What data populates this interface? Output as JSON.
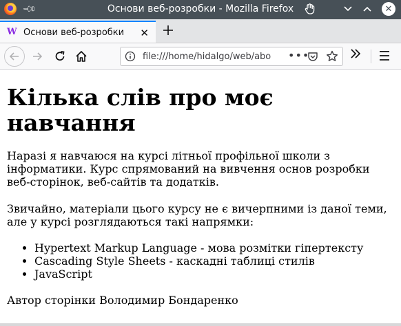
{
  "window": {
    "title": "Основи веб-розробки - Mozilla Firefox"
  },
  "tabs": [
    {
      "label": "Основи веб-розробки",
      "active": true
    }
  ],
  "navbar": {
    "url": "file:///home/hidalgo/web/abo",
    "page_actions": "•••"
  },
  "page": {
    "heading": "Кілька слів про моє навчання",
    "paragraph1": "Наразі я навчаюся на курсі літньої профільної школи з інформатики. Курс спрямований на вивчення основ розробки веб-сторінок, веб-сайтів та додатків.",
    "paragraph2": "Звичайно, матеріали цього курсу не є вичерпними із даної теми, але у курсі розглядаються такі напрямки:",
    "list": [
      "Hypertext Markup Language - мова розмітки гіпертексту",
      "Cascading Style Sheets - каскадні таблиці стилів",
      "JavaScript"
    ],
    "author": "Автор сторінки Володимир Бондаренко"
  },
  "colors": {
    "titlebar": "#475057",
    "tab_accent": "#0a84ff",
    "toolbar": "#f9f9fa"
  }
}
